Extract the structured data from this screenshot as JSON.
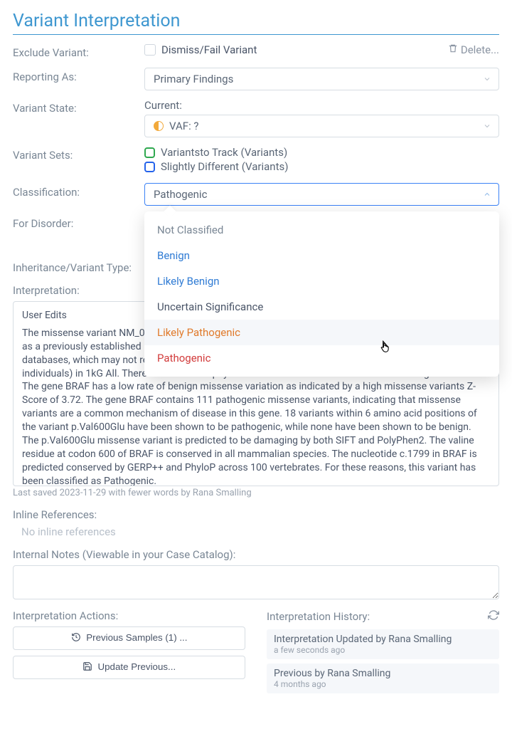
{
  "title": "Variant Interpretation",
  "labels": {
    "excludeVariant": "Exclude Variant:",
    "reportingAs": "Reporting As:",
    "variantState": "Variant State:",
    "variantSets": "Variant Sets:",
    "classification": "Classification:",
    "forDisorder": "For Disorder:",
    "inheritance": "Inheritance/Variant Type:",
    "interpretation": "Interpretation:",
    "inlineRefs": "Inline References:",
    "internalNotes": "Internal Notes (Viewable in your Case Catalog):",
    "interpActions": "Interpretation Actions:",
    "interpHistory": "Interpretation History:"
  },
  "dismiss": {
    "label": "Dismiss/Fail Variant"
  },
  "delete": {
    "label": "Delete..."
  },
  "reportingAs": {
    "value": "Primary Findings"
  },
  "variantState": {
    "currentLabel": "Current:",
    "value": "VAF: ?"
  },
  "variantSets": [
    {
      "label": "Variantsto Track (Variants)",
      "color": "green"
    },
    {
      "label": "Slightly Different (Variants)",
      "color": "blue"
    }
  ],
  "classification": {
    "value": "Pathogenic",
    "options": [
      {
        "label": "Not Classified",
        "color": "#7a8795"
      },
      {
        "label": "Benign",
        "color": "#2f7bd4"
      },
      {
        "label": "Likely Benign",
        "color": "#2f7bd4"
      },
      {
        "label": "Uncertain Significance",
        "color": "#4a5568"
      },
      {
        "label": "Likely Pathogenic",
        "color": "#e07a2b",
        "hover": true
      },
      {
        "label": "Pathogenic",
        "color": "#d23b3b"
      }
    ]
  },
  "interpretationBox": {
    "heading": "User Edits",
    "text": "The missense variant NM_004333.6(BRAF):c.1799T>A (p.Val600Glu) causes the same amino acid change as a previously established pathogenic variant. This variant is present at 0.00329% in gnomAD population databases, which may not represent the true population frequency (observed in both affected and healthy individuals) in 1kG All. There is a moderate physicochemical difference between valine and glutamic acid. The gene BRAF has a low rate of benign missense variation as indicated by a high missense variants Z-Score of 3.72. The gene BRAF contains 111 pathogenic missense variants, indicating that missense variants are a common mechanism of disease in this gene. 18 variants within 6 amino acid positions of the variant p.Val600Glu have been shown to be pathogenic, while none have been shown to be benign. The p.Val600Glu missense variant is predicted to be damaging by both SIFT and PolyPhen2. The valine residue at codon 600 of BRAF is conserved in all mammalian species. The nucleotide c.1799 in BRAF is predicted conserved by GERP++ and PhyloP across 100 vertebrates.  For these reasons, this variant has been classified as Pathogenic.",
    "savedNote": "Last saved 2023-11-29 with fewer words by Rana Smalling"
  },
  "inlineReferences": {
    "empty": "No inline references"
  },
  "actions": {
    "previous": "Previous Samples (1) ...",
    "update": "Update Previous..."
  },
  "history": [
    {
      "title": "Interpretation Updated by Rana Smalling",
      "when": "a few seconds ago"
    },
    {
      "title": "Previous by Rana Smalling",
      "when": "4 months ago"
    }
  ]
}
